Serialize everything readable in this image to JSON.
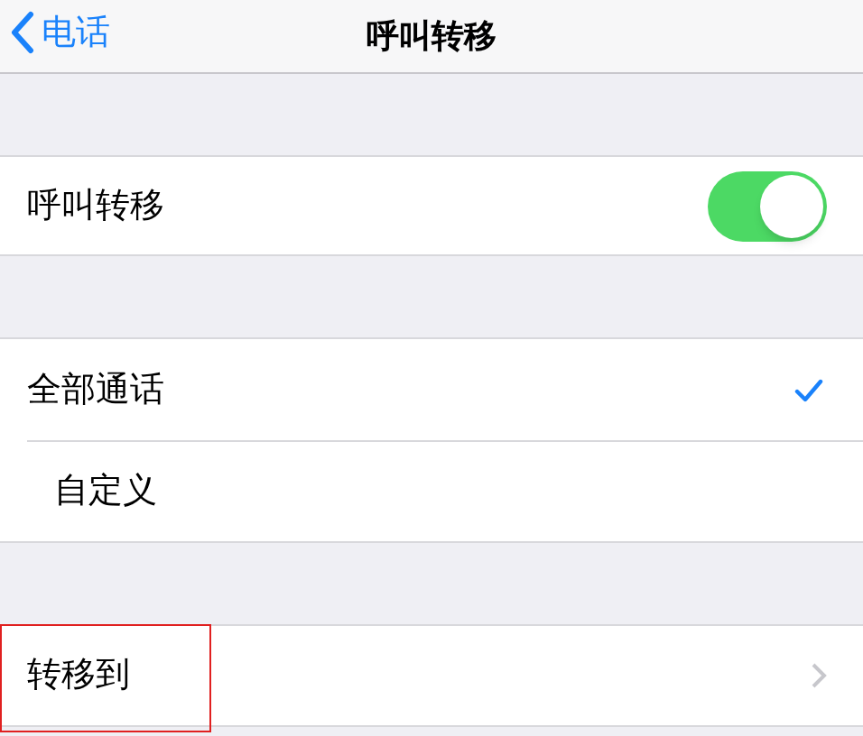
{
  "nav": {
    "back_label": "电话",
    "title": "呼叫转移"
  },
  "toggle_row": {
    "label": "呼叫转移",
    "on": true
  },
  "options": [
    {
      "label": "全部通话",
      "selected": true
    },
    {
      "label": "自定义",
      "selected": false
    }
  ],
  "forward_row": {
    "label": "转移到",
    "highlighted": true
  }
}
